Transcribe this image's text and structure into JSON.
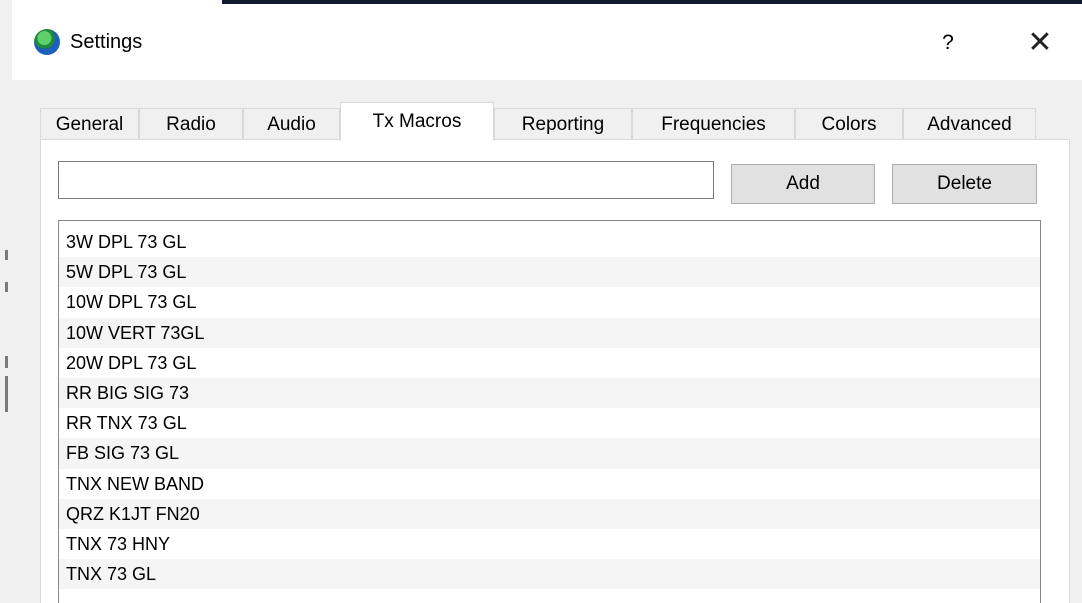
{
  "window": {
    "title": "Settings",
    "help_label": "?",
    "close_label": "✕"
  },
  "tabs": [
    {
      "label": "General",
      "active": false
    },
    {
      "label": "Radio",
      "active": false
    },
    {
      "label": "Audio",
      "active": false
    },
    {
      "label": "Tx Macros",
      "active": true
    },
    {
      "label": "Reporting",
      "active": false
    },
    {
      "label": "Frequencies",
      "active": false
    },
    {
      "label": "Colors",
      "active": false
    },
    {
      "label": "Advanced",
      "active": false
    }
  ],
  "macro_editor": {
    "input_value": "",
    "add_label": "Add",
    "delete_label": "Delete"
  },
  "macros": [
    "3W DPL 73 GL",
    "5W DPL 73 GL",
    "10W DPL 73 GL",
    "10W VERT 73GL",
    "20W DPL 73 GL",
    "RR BIG SIG 73",
    "RR TNX 73 GL",
    "FB SIG 73 GL",
    "TNX NEW BAND",
    "QRZ K1JT FN20",
    "TNX 73 HNY",
    "TNX 73 GL"
  ],
  "colors": {
    "dialog_bg": "#f0f0f0",
    "panel_bg": "#ffffff",
    "button_bg": "#e1e1e1",
    "alt_row_bg": "#f5f5f5"
  }
}
